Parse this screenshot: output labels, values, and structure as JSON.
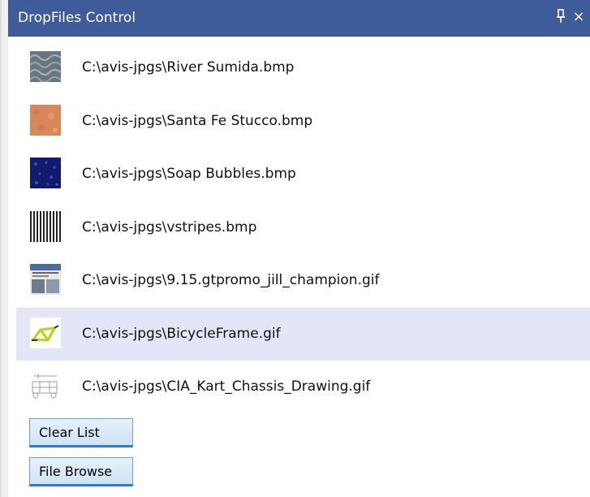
{
  "panel": {
    "title": "DropFiles Control",
    "pin_glyph": "⊥",
    "close_glyph": "×"
  },
  "files": [
    {
      "path": "C:\\avis-jpgs\\River Sumida.bmp",
      "thumb": "river-sumida-thumb",
      "selected": false
    },
    {
      "path": "C:\\avis-jpgs\\Santa Fe Stucco.bmp",
      "thumb": "santa-fe-stucco-thumb",
      "selected": false
    },
    {
      "path": "C:\\avis-jpgs\\Soap Bubbles.bmp",
      "thumb": "soap-bubbles-thumb",
      "selected": false
    },
    {
      "path": "C:\\avis-jpgs\\vstripes.bmp",
      "thumb": "vstripes-thumb",
      "selected": false
    },
    {
      "path": "C:\\avis-jpgs\\9.15.gtpromo_jill_champion.gif",
      "thumb": "gtpromo-thumb",
      "selected": false
    },
    {
      "path": "C:\\avis-jpgs\\BicycleFrame.gif",
      "thumb": "bicycle-frame-thumb",
      "selected": true
    },
    {
      "path": "C:\\avis-jpgs\\CIA_Kart_Chassis_Drawing.gif",
      "thumb": "kart-chassis-thumb",
      "selected": false
    }
  ],
  "buttons": {
    "clear_list": "Clear List",
    "file_browse": "File Browse"
  },
  "colors": {
    "titlebar": "#3e5c99",
    "selected_row": "#e4e5f7",
    "button_border": "#2f7ccc"
  }
}
